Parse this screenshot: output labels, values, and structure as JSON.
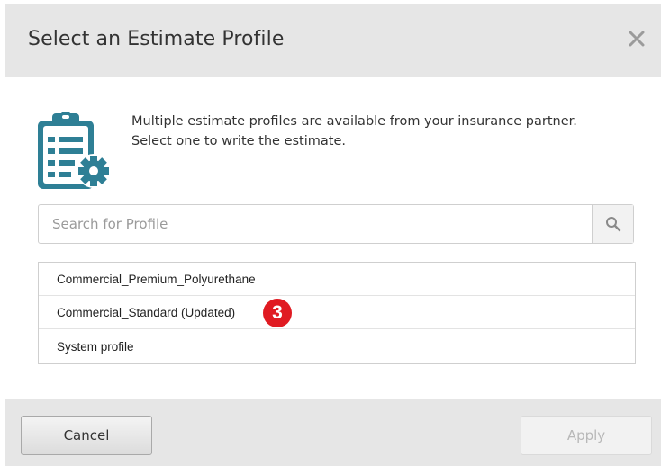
{
  "dialog": {
    "title": "Select an Estimate Profile",
    "close_icon": "close-icon"
  },
  "intro": {
    "icon": "clipboard-gear-icon",
    "line1": "Multiple estimate profiles are available from your insurance partner.",
    "line2": "Select one to write the estimate."
  },
  "search": {
    "placeholder": "Search for Profile",
    "value": "",
    "icon": "search-icon"
  },
  "profiles": [
    {
      "label": "Commercial_Premium_Polyurethane"
    },
    {
      "label": "Commercial_Standard (Updated)"
    },
    {
      "label": "System profile"
    }
  ],
  "annotation": {
    "step_badge": "3"
  },
  "footer": {
    "cancel_label": "Cancel",
    "apply_label": "Apply"
  },
  "colors": {
    "header_bg": "#e6e6e6",
    "icon_teal": "#2e7f95",
    "badge_red": "#e01b22"
  }
}
